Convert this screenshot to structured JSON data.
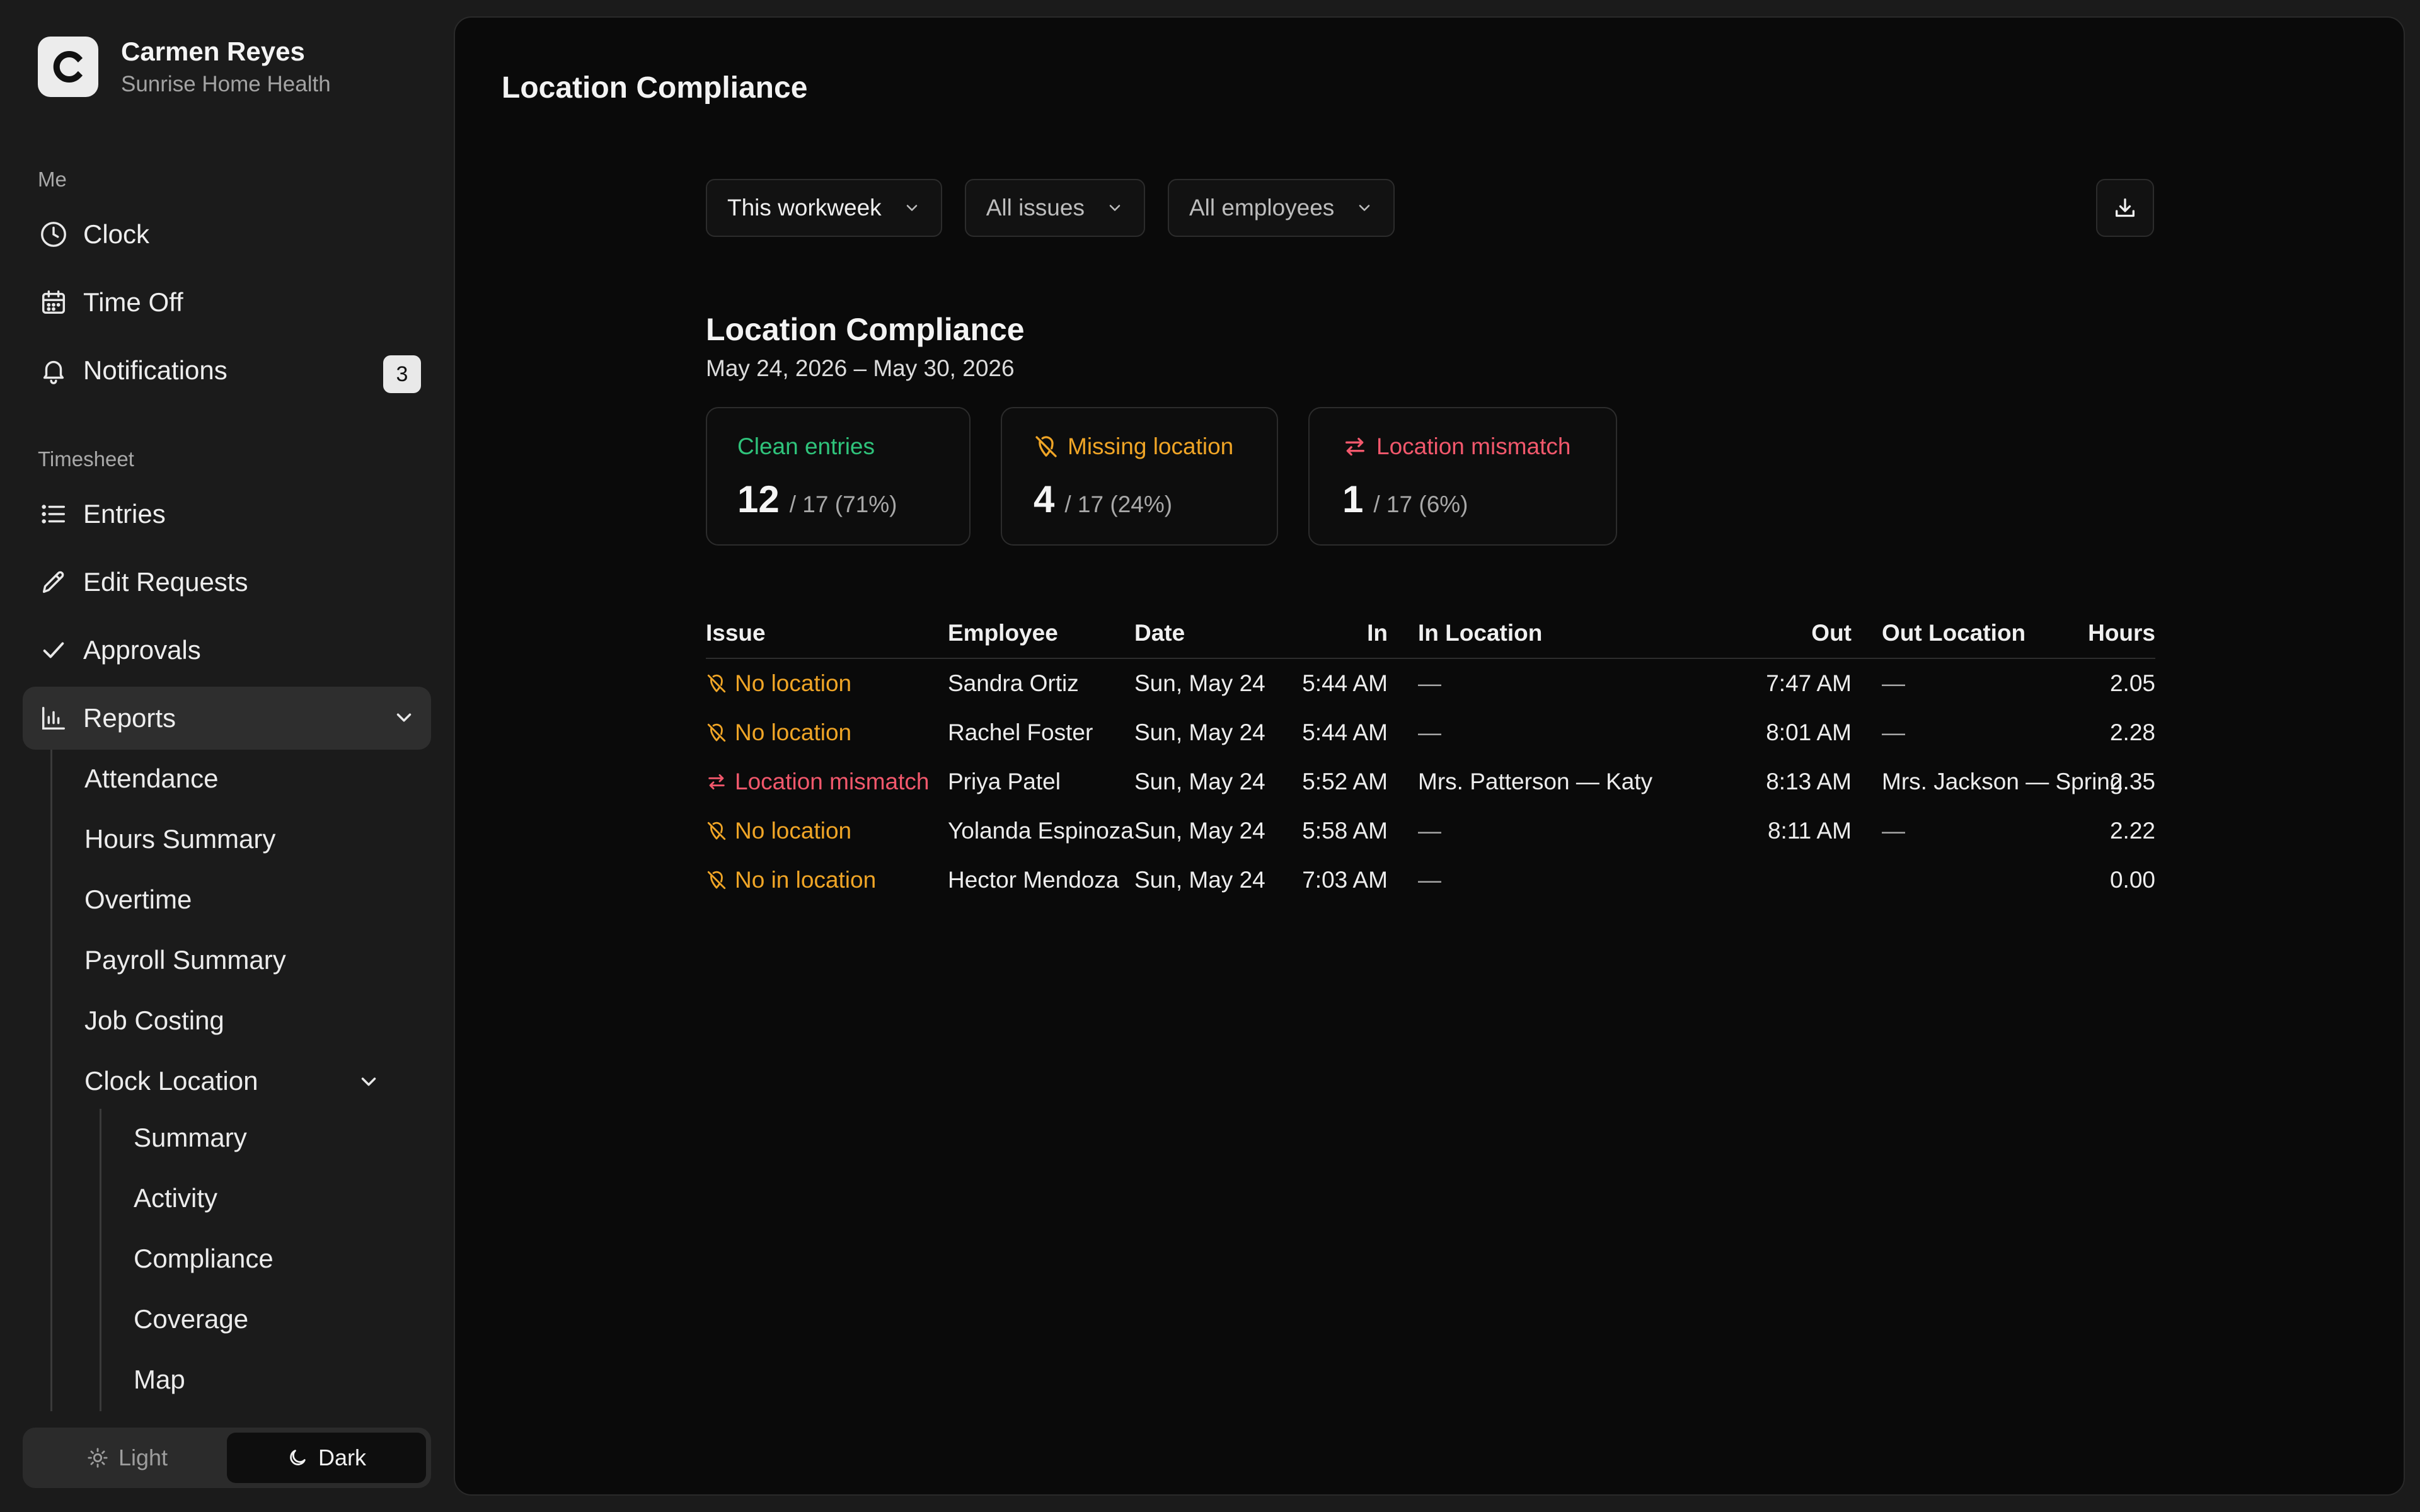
{
  "org": {
    "logo_letter": "C",
    "name": "Carmen Reyes",
    "company": "Sunrise Home Health"
  },
  "sidebar": {
    "me_label": "Me",
    "me_items": [
      {
        "label": "Clock",
        "icon": "clock-icon"
      },
      {
        "label": "Time Off",
        "icon": "calendar-icon"
      },
      {
        "label": "Notifications",
        "icon": "bell-icon",
        "badge": "3"
      }
    ],
    "timesheet_label": "Timesheet",
    "timesheet_items": [
      {
        "label": "Entries",
        "icon": "list-icon"
      },
      {
        "label": "Edit Requests",
        "icon": "pencil-icon"
      },
      {
        "label": "Approvals",
        "icon": "check-icon"
      },
      {
        "label": "Reports",
        "icon": "bar-chart-icon",
        "expanded": true
      }
    ],
    "reports_items": [
      "Attendance",
      "Hours Summary",
      "Overtime",
      "Payroll Summary",
      "Job Costing",
      "Clock Location"
    ],
    "clock_location_items": [
      "Summary",
      "Activity",
      "Compliance",
      "Coverage",
      "Map"
    ],
    "theme": {
      "light": "Light",
      "dark": "Dark",
      "selected": "Dark"
    }
  },
  "main": {
    "page_title": "Location Compliance",
    "filters": {
      "period": "This workweek",
      "issues": "All issues",
      "employees": "All employees"
    },
    "report_title": "Location Compliance",
    "date_range": "May 24, 2026 – May 30, 2026",
    "stats": [
      {
        "label": "Clean entries",
        "value": "12",
        "detail": "/ 17 (71%)",
        "color": "#2fc37b"
      },
      {
        "label": "Missing location",
        "value": "4",
        "detail": "/ 17 (24%)",
        "color": "#f0a526"
      },
      {
        "label": "Location mismatch",
        "value": "1",
        "detail": "/ 17 (6%)",
        "color": "#f2586c"
      }
    ],
    "table": {
      "headers": {
        "issue": "Issue",
        "employee": "Employee",
        "date": "Date",
        "in": "In",
        "in_location": "In Location",
        "out": "Out",
        "out_location": "Out Location",
        "hours": "Hours"
      },
      "rows": [
        {
          "issue": "No location",
          "issue_type": "missing",
          "employee": "Sandra Ortiz",
          "date": "Sun, May 24",
          "in": "5:44 AM",
          "in_location": "—",
          "out": "7:47 AM",
          "out_location": "—",
          "hours": "2.05"
        },
        {
          "issue": "No location",
          "issue_type": "missing",
          "employee": "Rachel Foster",
          "date": "Sun, May 24",
          "in": "5:44 AM",
          "in_location": "—",
          "out": "8:01 AM",
          "out_location": "—",
          "hours": "2.28"
        },
        {
          "issue": "Location mismatch",
          "issue_type": "mismatch",
          "employee": "Priya Patel",
          "date": "Sun, May 24",
          "in": "5:52 AM",
          "in_location": "Mrs. Patterson — Katy",
          "out": "8:13 AM",
          "out_location": "Mrs. Jackson — Spring",
          "hours": "2.35"
        },
        {
          "issue": "No location",
          "issue_type": "missing",
          "employee": "Yolanda Espinoza",
          "date": "Sun, May 24",
          "in": "5:58 AM",
          "in_location": "—",
          "out": "8:11 AM",
          "out_location": "—",
          "hours": "2.22"
        },
        {
          "issue": "No in location",
          "issue_type": "missing",
          "employee": "Hector Mendoza",
          "date": "Sun, May 24",
          "in": "7:03 AM",
          "in_location": "—",
          "out": "",
          "out_location": "",
          "hours": "0.00"
        }
      ]
    }
  }
}
